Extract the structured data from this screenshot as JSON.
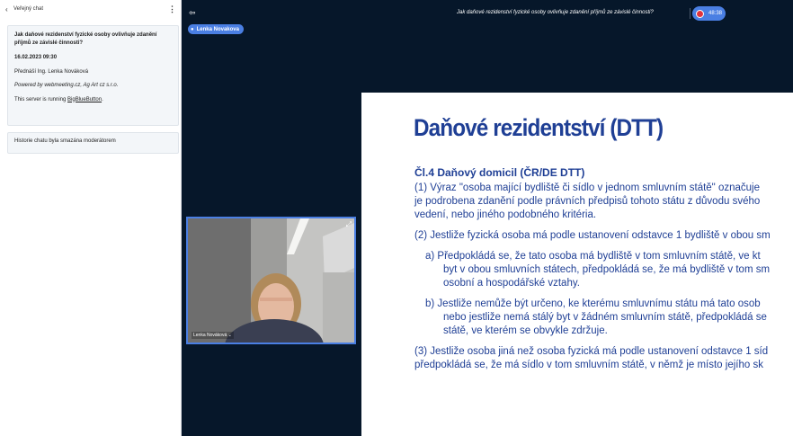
{
  "chat": {
    "back_icon": "chevron-left-icon",
    "title": "Veřejný chat",
    "menu_icon": "kebab-icon",
    "welcome": {
      "question": "Jak daňové rezidenství fyzické osoby ovlivňuje zdanění příjmů ze závislé činnosti?",
      "datetime": "16.02.2023 09:30",
      "lecturer": "Přednáší Ing. Lenka Nováková",
      "powered": "Powered by webmeeting.cz, Ag Art cz s.r.o.",
      "server_prefix": "This server is running ",
      "server_link": "BigBlueButton",
      "server_suffix": "."
    },
    "notice": "Historie chatu byla smazána moderátorem"
  },
  "topbar": {
    "users_icon": "users-toggle-icon",
    "meeting_title": "Jak daňové rezidenství fyzické osoby ovlivňuje zdanění příjmů ze závislé činnosti?",
    "recording_time": "48:38"
  },
  "talker": {
    "name": "Lenka Novakova"
  },
  "webcam": {
    "label": "Lenka Nováková ⌄"
  },
  "slide": {
    "title": "Daňové rezidentství (DTT)",
    "heading": "Čl.4 Daňový domicil (ČR/DE DTT)",
    "lines": [
      "(1)  Výraz \"osoba mající bydliště či sídlo v jednom smluvním státě\" označuje",
      " je podrobena zdanění podle právních předpisů tohoto státu z důvodu svého",
      " vedení, nebo jiného podobného kritéria.",
      "(2) Jestliže fyzická osoba má podle ustanovení odstavce 1 bydliště v obou sm",
      "a)   Předpokládá se, že tato osoba má bydliště v tom smluvním státě, ve kt",
      "byt v obou smluvních státech, předpokládá se, že má bydliště v tom sm",
      "osobní a hospodářské vztahy.",
      "b)   Jestliže nemůže být určeno, ke kterému smluvnímu státu má tato osob",
      "nebo jestliže nemá stálý byt v žádném smluvním státě, předpokládá se",
      "státě, ve kterém se obvykle zdržuje.",
      "(3) Jestliže osoba jiná než osoba fyzická má podle ustanovení odstavce 1 síd",
      "předpokládá se, že má sídlo v tom smluvním státě, v němž je místo jejího sk"
    ]
  }
}
